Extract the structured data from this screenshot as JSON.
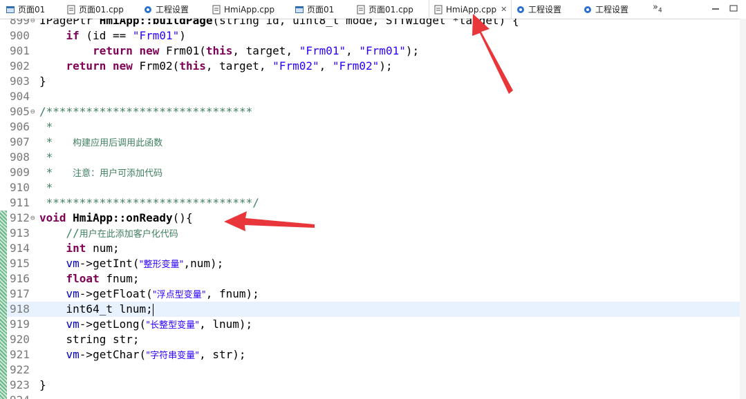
{
  "tabs": [
    {
      "label": "页面01",
      "icon": "form-icon"
    },
    {
      "label": "页面01.cpp",
      "icon": "cpp-file-icon"
    },
    {
      "label": "工程设置",
      "icon": "gear-icon"
    },
    {
      "label": "HmiApp.cpp",
      "icon": "cpp-file-icon"
    },
    {
      "label": "页面01",
      "icon": "form-icon"
    },
    {
      "label": "页面01.cpp",
      "icon": "cpp-file-icon"
    },
    {
      "label": "HmiApp.cpp",
      "icon": "cpp-file-icon",
      "active": true
    },
    {
      "label": "工程设置",
      "icon": "gear-icon"
    },
    {
      "label": "工程设置",
      "icon": "gear-icon"
    }
  ],
  "overflow": {
    "symbol": "»",
    "count": "4"
  },
  "colors": {
    "keyword": "#7f0055",
    "string": "#2a00ff",
    "comment": "#3f7f5f",
    "arrow": "#e8363a",
    "current_line": "#e8f2fe"
  },
  "lines": [
    {
      "n": "899",
      "fold": "⊖",
      "parts": [
        [
          "",
          "IPagePtr "
        ],
        [
          "fn",
          "HmiApp::buildPage"
        ],
        [
          "",
          "(string id, uint8_t mode, STTWidget *target) {"
        ]
      ]
    },
    {
      "n": "900",
      "parts": [
        [
          "",
          "    "
        ],
        [
          "kw",
          "if"
        ],
        [
          "",
          " (id == "
        ],
        [
          "str",
          "\"Frm01\""
        ],
        [
          "",
          ")"
        ]
      ]
    },
    {
      "n": "901",
      "parts": [
        [
          "",
          "        "
        ],
        [
          "kw",
          "return"
        ],
        [
          "",
          " "
        ],
        [
          "kw",
          "new"
        ],
        [
          "",
          " Frm01("
        ],
        [
          "kw",
          "this"
        ],
        [
          "",
          ", target, "
        ],
        [
          "str",
          "\"Frm01\""
        ],
        [
          "",
          ", "
        ],
        [
          "str",
          "\"Frm01\""
        ],
        [
          "",
          ");"
        ]
      ]
    },
    {
      "n": "902",
      "parts": [
        [
          "",
          "    "
        ],
        [
          "kw",
          "return"
        ],
        [
          "",
          " "
        ],
        [
          "kw",
          "new"
        ],
        [
          "",
          " Frm02("
        ],
        [
          "kw",
          "this"
        ],
        [
          "",
          ", target, "
        ],
        [
          "str",
          "\"Frm02\""
        ],
        [
          "",
          ", "
        ],
        [
          "str",
          "\"Frm02\""
        ],
        [
          "",
          ");"
        ]
      ]
    },
    {
      "n": "903",
      "parts": [
        [
          "",
          "}"
        ]
      ]
    },
    {
      "n": "904",
      "parts": []
    },
    {
      "n": "905",
      "fold": "⊖",
      "parts": [
        [
          "cmt",
          "/*******************************"
        ]
      ]
    },
    {
      "n": "906",
      "parts": [
        [
          "cmt",
          " *"
        ]
      ]
    },
    {
      "n": "907",
      "parts": [
        [
          "cmt",
          " *   "
        ],
        [
          "cmt cjk",
          "构建应用后调用此函数"
        ]
      ]
    },
    {
      "n": "908",
      "parts": [
        [
          "cmt",
          " *"
        ]
      ]
    },
    {
      "n": "909",
      "parts": [
        [
          "cmt",
          " *   "
        ],
        [
          "cmt cjk",
          "注意：用户可添加代码"
        ]
      ]
    },
    {
      "n": "910",
      "parts": [
        [
          "cmt",
          " *"
        ]
      ]
    },
    {
      "n": "911",
      "parts": [
        [
          "cmt",
          " *******************************/"
        ]
      ]
    },
    {
      "n": "912",
      "fold": "⊖",
      "parts": [
        [
          "kw",
          "void"
        ],
        [
          "",
          " "
        ],
        [
          "fn",
          "HmiApp::onReady"
        ],
        [
          "",
          "(){"
        ]
      ]
    },
    {
      "n": "913",
      "parts": [
        [
          "cmt",
          "    //"
        ],
        [
          "cmt cjk",
          "用户在此添加客户化代码"
        ]
      ]
    },
    {
      "n": "914",
      "parts": [
        [
          "",
          "    "
        ],
        [
          "kw",
          "int"
        ],
        [
          "",
          " num;"
        ]
      ]
    },
    {
      "n": "915",
      "parts": [
        [
          "",
          "    "
        ],
        [
          "var",
          "vm"
        ],
        [
          "",
          "->getInt("
        ],
        [
          "str cjk",
          "\"整形变量\""
        ],
        [
          "",
          ",num);"
        ]
      ]
    },
    {
      "n": "916",
      "parts": [
        [
          "",
          "    "
        ],
        [
          "kw",
          "float"
        ],
        [
          "",
          " fnum;"
        ]
      ]
    },
    {
      "n": "917",
      "parts": [
        [
          "",
          "    "
        ],
        [
          "var",
          "vm"
        ],
        [
          "",
          "->getFloat("
        ],
        [
          "str cjk",
          "\"浮点型变量\""
        ],
        [
          "",
          ", fnum);"
        ]
      ]
    },
    {
      "n": "918",
      "current": true,
      "parts": [
        [
          "",
          "    int64_t lnum;"
        ]
      ]
    },
    {
      "n": "919",
      "parts": [
        [
          "",
          "    "
        ],
        [
          "var",
          "vm"
        ],
        [
          "",
          "->getLong("
        ],
        [
          "str cjk",
          "\"长整型变量\""
        ],
        [
          "",
          ", lnum);"
        ]
      ]
    },
    {
      "n": "920",
      "parts": [
        [
          "",
          "    string str;"
        ]
      ]
    },
    {
      "n": "921",
      "parts": [
        [
          "",
          "    "
        ],
        [
          "var",
          "vm"
        ],
        [
          "",
          "->getChar("
        ],
        [
          "str cjk",
          "\"字符串变量\""
        ],
        [
          "",
          ", str);"
        ]
      ]
    },
    {
      "n": "922",
      "parts": []
    },
    {
      "n": "923",
      "parts": [
        [
          "",
          "}"
        ]
      ]
    },
    {
      "n": "924",
      "parts": []
    }
  ]
}
